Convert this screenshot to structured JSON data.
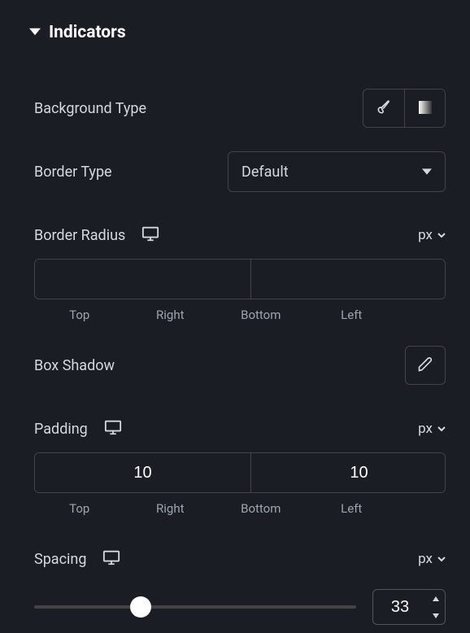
{
  "section": {
    "title": "Indicators"
  },
  "background": {
    "label": "Background Type"
  },
  "borderType": {
    "label": "Border Type",
    "value": "Default"
  },
  "borderRadius": {
    "label": "Border Radius",
    "unit": "px",
    "top": "",
    "right": "",
    "bottom": "",
    "left": "",
    "sides": {
      "top": "Top",
      "right": "Right",
      "bottom": "Bottom",
      "left": "Left"
    }
  },
  "boxShadow": {
    "label": "Box Shadow"
  },
  "padding": {
    "label": "Padding",
    "unit": "px",
    "top": "10",
    "right": "10",
    "bottom": "10",
    "left": "10",
    "sides": {
      "top": "Top",
      "right": "Right",
      "bottom": "Bottom",
      "left": "Left"
    }
  },
  "spacing": {
    "label": "Spacing",
    "unit": "px",
    "value": "33",
    "percent": 33
  }
}
